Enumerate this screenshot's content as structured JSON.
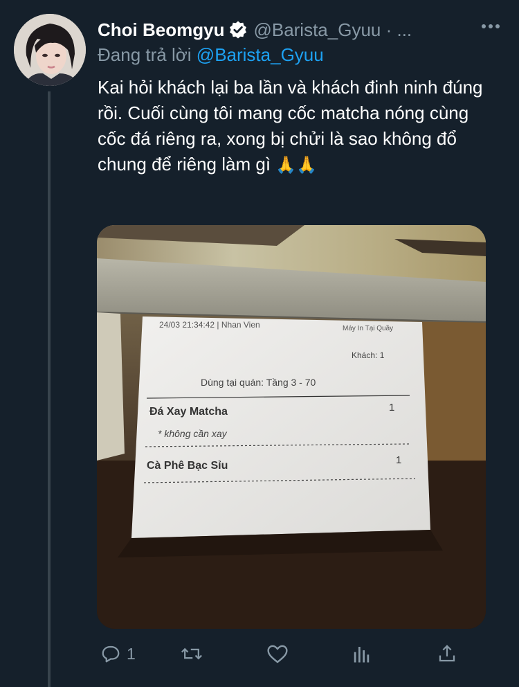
{
  "tweet": {
    "author_name": "Choi Beomgyu",
    "handle": "@Barista_Gyuu · ...",
    "reply_prefix": "Đang trả lời",
    "reply_mention": "@Barista_Gyuu",
    "text": "Kai hỏi khách lại ba lần và khách đinh ninh đúng rồi. Cuối cùng tôi mang cốc matcha nóng cùng cốc đá riêng ra, xong bị chửi là sao không đổ chung để riêng làm gì",
    "emoji": "🙏🙏",
    "reply_count": "1"
  },
  "receipt": {
    "datetime": "24/03 21:34:42 | Nhan Vien",
    "printer": "Máy In Tại Quầy",
    "guests": "Khách: 1",
    "table": "Dùng tại quán: Tầng 3 - 70",
    "items": [
      {
        "name": "Đá Xay Matcha",
        "qty": "1",
        "note": "* không cần xay"
      },
      {
        "name": "Cà Phê Bạc Sỉu",
        "qty": "1"
      }
    ]
  },
  "colors": {
    "background": "#15202b",
    "secondary_text": "#8899a6",
    "link": "#1da1f2"
  },
  "icons": [
    "verified-badge-icon",
    "more-icon",
    "reply-icon",
    "retweet-icon",
    "like-icon",
    "analytics-icon",
    "share-icon"
  ]
}
